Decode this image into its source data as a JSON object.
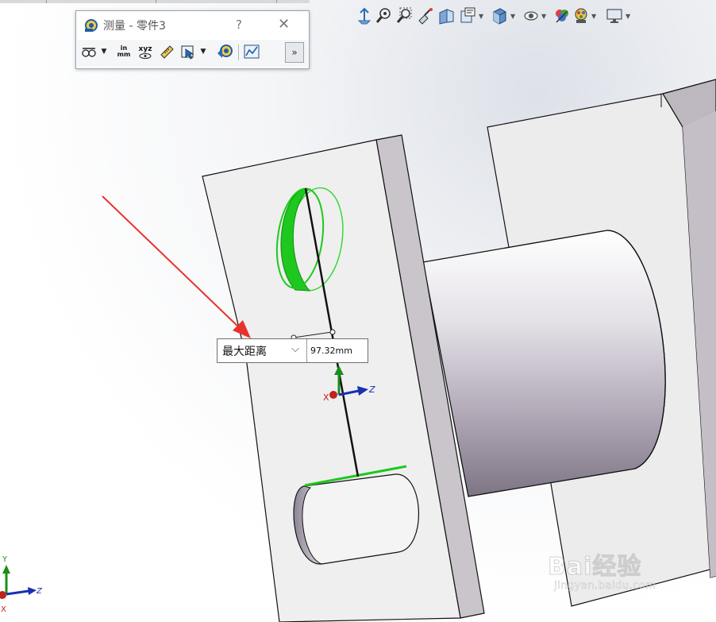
{
  "dialog": {
    "title": "测量 - 零件3",
    "help_label": "?",
    "close_label": "✕",
    "units_top": "in",
    "units_bottom": "mm",
    "xyz_label": "xyz",
    "expand_label": "»"
  },
  "callout": {
    "measure_type": "最大距离",
    "value": "97.32mm"
  },
  "triad_model": {
    "x": "X",
    "y": "Y",
    "z": "Z"
  },
  "triad_corner": {
    "x": "X",
    "y": "Y",
    "z": "Z"
  },
  "watermark": {
    "brand": "Bai经验",
    "url": "jingyan.baidu.com"
  },
  "colors": {
    "selection_green": "#1ec81e",
    "annotation_red": "#e8322d",
    "axis_red": "#c0221d",
    "axis_green": "#1a8f1a",
    "axis_blue": "#1b2fb0"
  }
}
